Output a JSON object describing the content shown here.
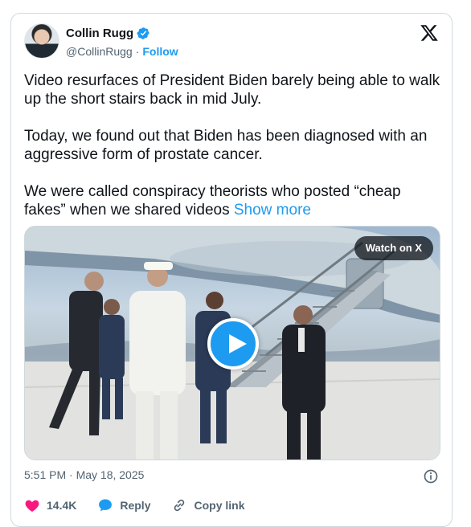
{
  "author": {
    "name": "Collin Rugg",
    "handle": "@CollinRugg",
    "separator": "·",
    "follow_label": "Follow"
  },
  "post": {
    "paragraphs": [
      "Video resurfaces of President Biden barely being able to walk up the short stairs back in mid July.",
      "Today, we found out that Biden has been diagnosed with an aggressive form of prostate cancer.",
      "We were called conspiracy theorists who posted “cheap fakes” when we shared videos"
    ],
    "show_more_label": "Show more"
  },
  "media": {
    "watch_label": "Watch on X"
  },
  "meta": {
    "timestamp": "5:51 PM · May 18, 2025"
  },
  "actions": {
    "like_count": "14.4K",
    "reply_label": "Reply",
    "copy_link_label": "Copy link"
  },
  "colors": {
    "accent": "#1d9bf0",
    "like": "#f91880",
    "secondary_text": "#536471"
  },
  "icons": [
    "verified-badge-icon",
    "x-logo-icon",
    "play-icon",
    "info-icon",
    "heart-icon",
    "reply-bubble-icon",
    "link-icon"
  ]
}
